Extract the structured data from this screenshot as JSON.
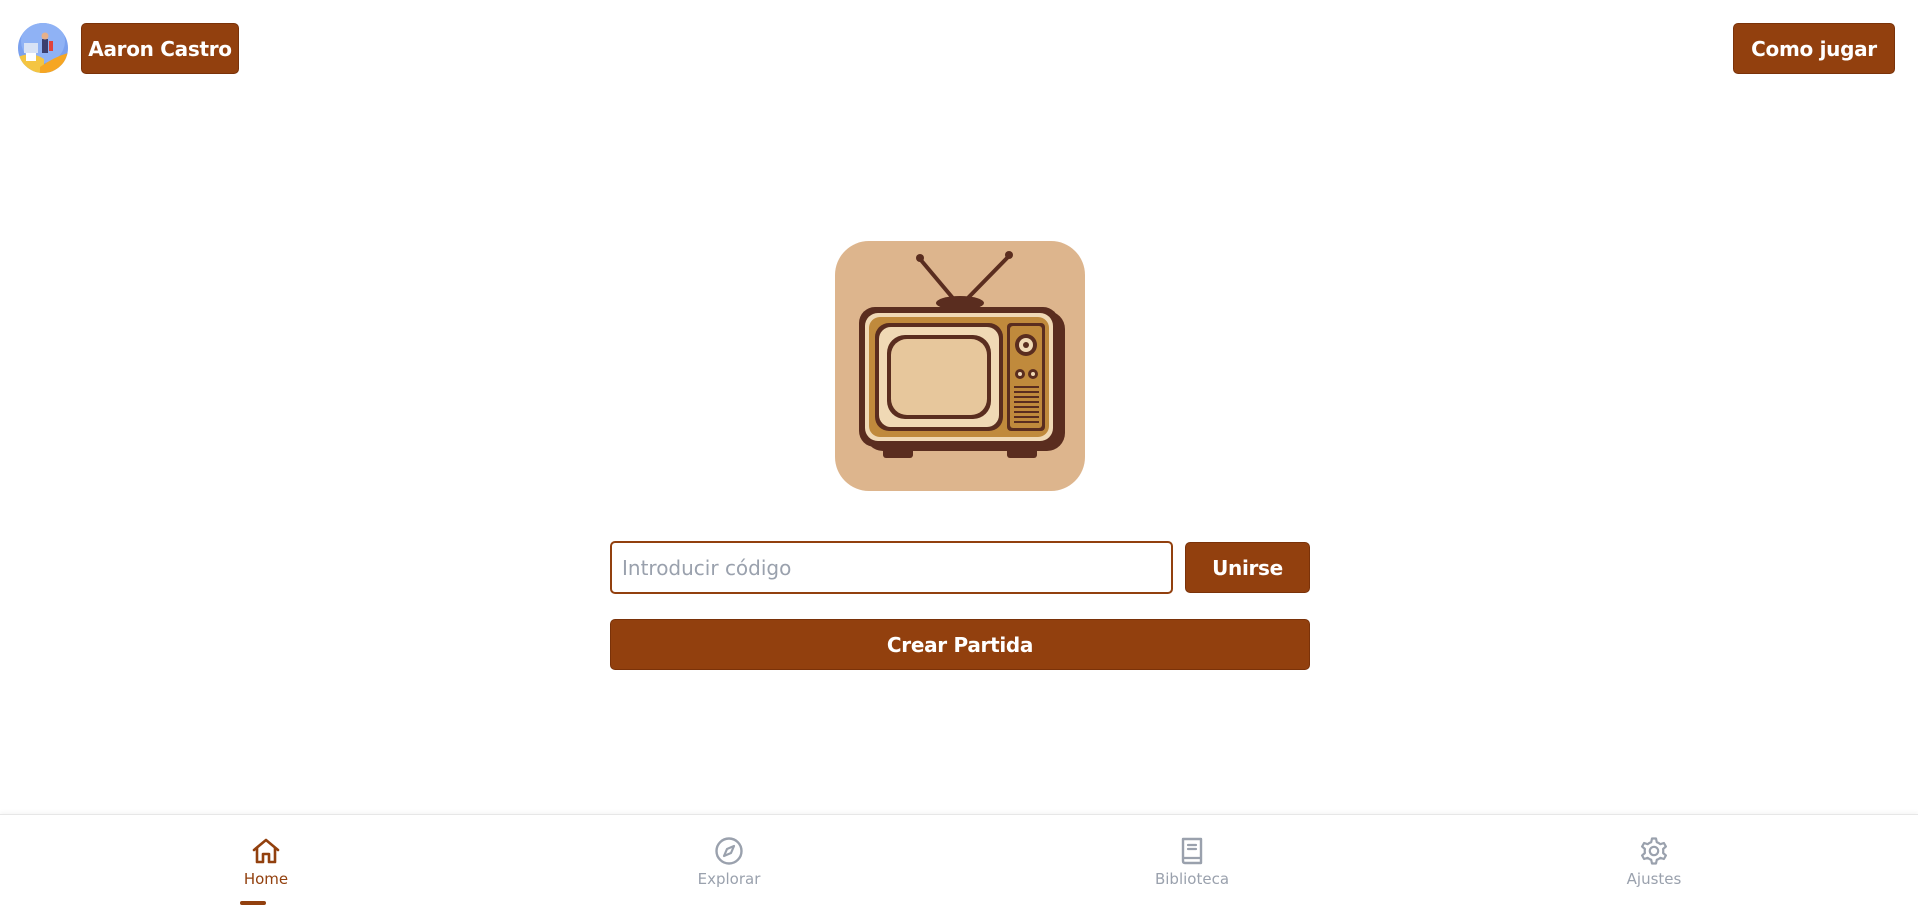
{
  "header": {
    "user_name": "Aaron Castro",
    "how_to_play_label": "Como jugar"
  },
  "join": {
    "code_placeholder": "Introducir código",
    "code_value": "",
    "join_label": "Unirse",
    "create_label": "Crear Partida"
  },
  "nav": {
    "items": [
      {
        "label": "Home",
        "icon": "home-icon",
        "active": true
      },
      {
        "label": "Explorar",
        "icon": "compass-icon",
        "active": false
      },
      {
        "label": "Biblioteca",
        "icon": "book-icon",
        "active": false
      },
      {
        "label": "Ajustes",
        "icon": "gear-icon",
        "active": false
      }
    ]
  },
  "colors": {
    "primary": "#92400e",
    "inactive": "#9aa1ad",
    "logo_bg": "#ddb58d"
  }
}
